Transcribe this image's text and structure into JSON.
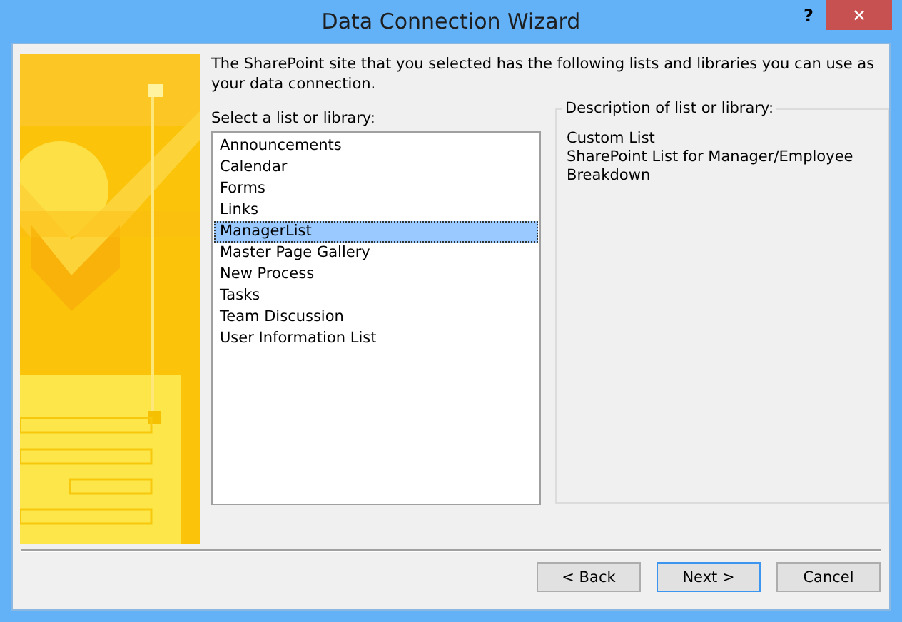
{
  "window": {
    "title": "Data Connection Wizard",
    "help": "?",
    "close": "✕"
  },
  "intro": "The SharePoint site that you selected has the following lists and libraries you can use as your data connection.",
  "list_label": "Select a list or library:",
  "list_items": [
    {
      "label": "Announcements",
      "selected": false
    },
    {
      "label": "Calendar",
      "selected": false
    },
    {
      "label": "Forms",
      "selected": false
    },
    {
      "label": "Links",
      "selected": false
    },
    {
      "label": "ManagerList",
      "selected": true
    },
    {
      "label": "Master Page Gallery",
      "selected": false
    },
    {
      "label": "New Process",
      "selected": false
    },
    {
      "label": "Tasks",
      "selected": false
    },
    {
      "label": "Team Discussion",
      "selected": false
    },
    {
      "label": "User Information List",
      "selected": false
    }
  ],
  "description": {
    "title": "Description of list or library:",
    "lines": [
      "Custom List",
      "SharePoint List for Manager/Employee Breakdown"
    ]
  },
  "buttons": [
    {
      "label": "< Back",
      "default": false
    },
    {
      "label": "Next >",
      "default": true
    },
    {
      "label": "Cancel",
      "default": false
    }
  ]
}
